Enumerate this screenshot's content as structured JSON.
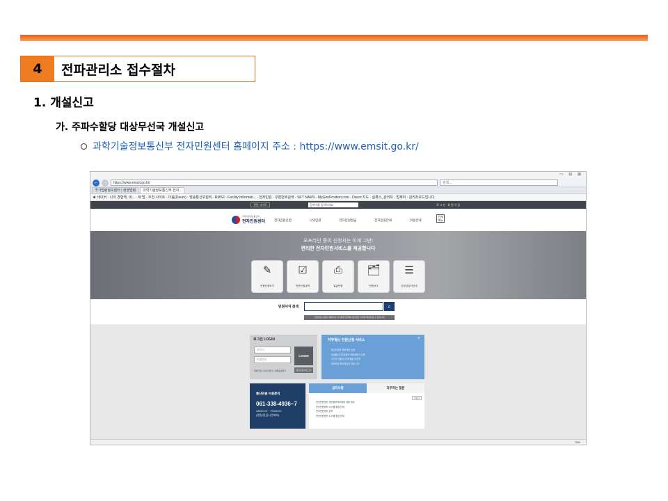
{
  "slide": {
    "section_number": "4",
    "section_title": "전파관리소 접수절차",
    "heading1": "1. 개설신고",
    "heading2": "가. 주파수할당 대상무선국 개설신고",
    "bullet_text": "과학기술정보통신부 전자민원센터 홈페이지 주소 : https://www.emsit.go.kr/",
    "accent_color": "#f07c22",
    "link_color": "#1f5fbf"
  },
  "browser": {
    "window_controls": "▭ ⊟ ⊠",
    "url": "https://www.emsit.go.kr/",
    "search_placeholder": "검색...",
    "tabs": [
      "국가법령정보센터 | 현행법령",
      "과학기술정보통신부 전자..."
    ],
    "favorites": "★ 네이버 · 나의 경험책, 네... · 새 탭 · 추천 사이트 · 다음(Daum) · 방송통신위원회 · RMS2 - Facility Informati... · 전자민원 · 우편번호검색 · SKT NAMS · MyGeoPosition.com · Daum 지도 · 실록스_관리자 · 법제처 · 관리자모드입니다."
  },
  "site": {
    "lang_btn": "관련 사이트",
    "top_search_placeholder": "검색어를 입력하세요",
    "top_links": "로그인 회원가입",
    "logo_small": "과학기술정보통신부",
    "logo_main": "전자민원센터",
    "nav_items": [
      "전자민원신청",
      "나의민원",
      "전자민원발급",
      "전자민원안내",
      "이용안내"
    ],
    "nav_box_label": "전체메뉴",
    "hero_line1": "오프라인 종이 신청서는 이제 그만!",
    "hero_line2": "편리한 전자민원서비스를 제공합니다",
    "hero_buttons": [
      {
        "icon": "✎",
        "label": "민원신청하기"
      },
      {
        "icon": "☑",
        "label": "민원신청내역"
      },
      {
        "icon": "⎙",
        "label": "발급민원"
      },
      {
        "icon": "🗂",
        "label": "민원서식"
      },
      {
        "icon": "☰",
        "label": "업무담당자안내"
      }
    ],
    "search_label": "민원서식 검색",
    "search_hint": "신청하실 민원의 제목이나 서식명을 입력하시면 관련 서식을 확인하실 수 있습니다",
    "login": {
      "title": "로그인 LOGIN",
      "id_placeholder": "아이디",
      "pw_placeholder": "비밀번호",
      "button": "LOGIN",
      "cert_button": "공인인증서로그인",
      "small_links": "회원가입 | 아이디찾기 | 비밀번호찾기"
    },
    "faq": {
      "title": "자주찾는 민원신청 서비스",
      "plus": "+",
      "items": [
        "· 통신사업자 정부재정 공개",
        "· 방송통신기자재등의 적합성평가 신청",
        "· 무선국 개설신고(재개설) 무선국",
        "· 정보보호 최고책임자 지정 신고"
      ]
    },
    "call": {
      "title": "통신민원 이용문의",
      "number": "061-338-4936~7",
      "hours1": "AM09:00 ~ PM06:00",
      "hours2": "(평일/점심시간제외)"
    },
    "notice": {
      "tab1": "공지사항",
      "tab2": "자주하는 질문",
      "more": "더보기",
      "items": [
        "전자민원센터 개인정보처리방침 개정 안내",
        "전자민원센터 시스템 점검 안내",
        "전자민원센터 공지",
        "전자민원센터 시스템 점검 안내"
      ]
    },
    "zoom": "75%"
  }
}
